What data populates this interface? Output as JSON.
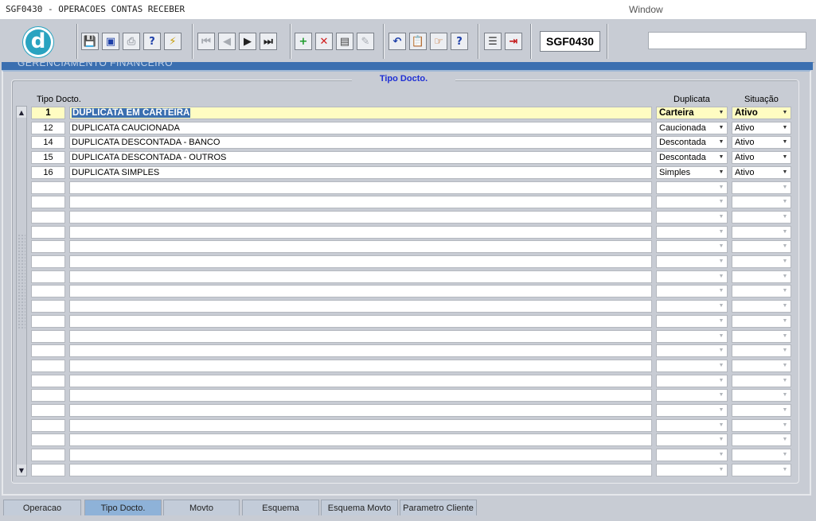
{
  "window": {
    "title": "SGF0430 - OPERACOES CONTAS RECEBER",
    "menu_window": "Window"
  },
  "toolbar": {
    "logo_letter": "d",
    "form_code": "SGF0430",
    "buttons": [
      {
        "name": "save-icon",
        "glyph": "💾"
      },
      {
        "name": "screen-icon",
        "glyph": "▣"
      },
      {
        "name": "print-icon",
        "glyph": "⎙"
      },
      {
        "name": "query-icon",
        "glyph": "?"
      },
      {
        "name": "execute-query-icon",
        "glyph": "⚡"
      },
      {
        "name": "first-record-icon",
        "glyph": "⏮"
      },
      {
        "name": "prev-record-icon",
        "glyph": "◀"
      },
      {
        "name": "next-record-icon",
        "glyph": "▶"
      },
      {
        "name": "last-record-icon",
        "glyph": "⏭"
      },
      {
        "name": "insert-record-icon",
        "glyph": "+"
      },
      {
        "name": "delete-record-icon",
        "glyph": "✕"
      },
      {
        "name": "lov-icon",
        "glyph": "▤"
      },
      {
        "name": "edit-icon",
        "glyph": "✎"
      },
      {
        "name": "undo-icon",
        "glyph": "↶"
      },
      {
        "name": "clipboard-icon",
        "glyph": "📋"
      },
      {
        "name": "hand-icon",
        "glyph": "☞"
      },
      {
        "name": "help-icon",
        "glyph": "?"
      },
      {
        "name": "menu-icon",
        "glyph": "☰"
      },
      {
        "name": "exit-icon",
        "glyph": "⇥"
      }
    ]
  },
  "canvas": {
    "header_text": "GERENCIAMENTO FINANCEIRO",
    "group_title": "Tipo Docto."
  },
  "columns": {
    "tipo_docto": "Tipo Docto.",
    "duplicata": "Duplicata",
    "situacao": "Situação"
  },
  "rows": [
    {
      "code": "1",
      "description": "DUPLICATA EM CARTEIRA",
      "duplicata": "Carteira",
      "situacao": "Ativo"
    },
    {
      "code": "12",
      "description": "DUPLICATA CAUCIONADA",
      "duplicata": "Caucionada",
      "situacao": "Ativo"
    },
    {
      "code": "14",
      "description": "DUPLICATA DESCONTADA - BANCO",
      "duplicata": "Descontada",
      "situacao": "Ativo"
    },
    {
      "code": "15",
      "description": "DUPLICATA DESCONTADA - OUTROS",
      "duplicata": "Descontada",
      "situacao": "Ativo"
    },
    {
      "code": "16",
      "description": "DUPLICATA SIMPLES",
      "duplicata": "Simples",
      "situacao": "Ativo"
    }
  ],
  "empty_row_count": 20,
  "tabs": [
    {
      "label": "Operacao",
      "active": false
    },
    {
      "label": "Tipo Docto.",
      "active": true
    },
    {
      "label": "Movto",
      "active": false
    },
    {
      "label": "Esquema",
      "active": false
    },
    {
      "label": "Esquema Movto",
      "active": false
    },
    {
      "label": "Parametro Cliente",
      "active": false
    }
  ]
}
